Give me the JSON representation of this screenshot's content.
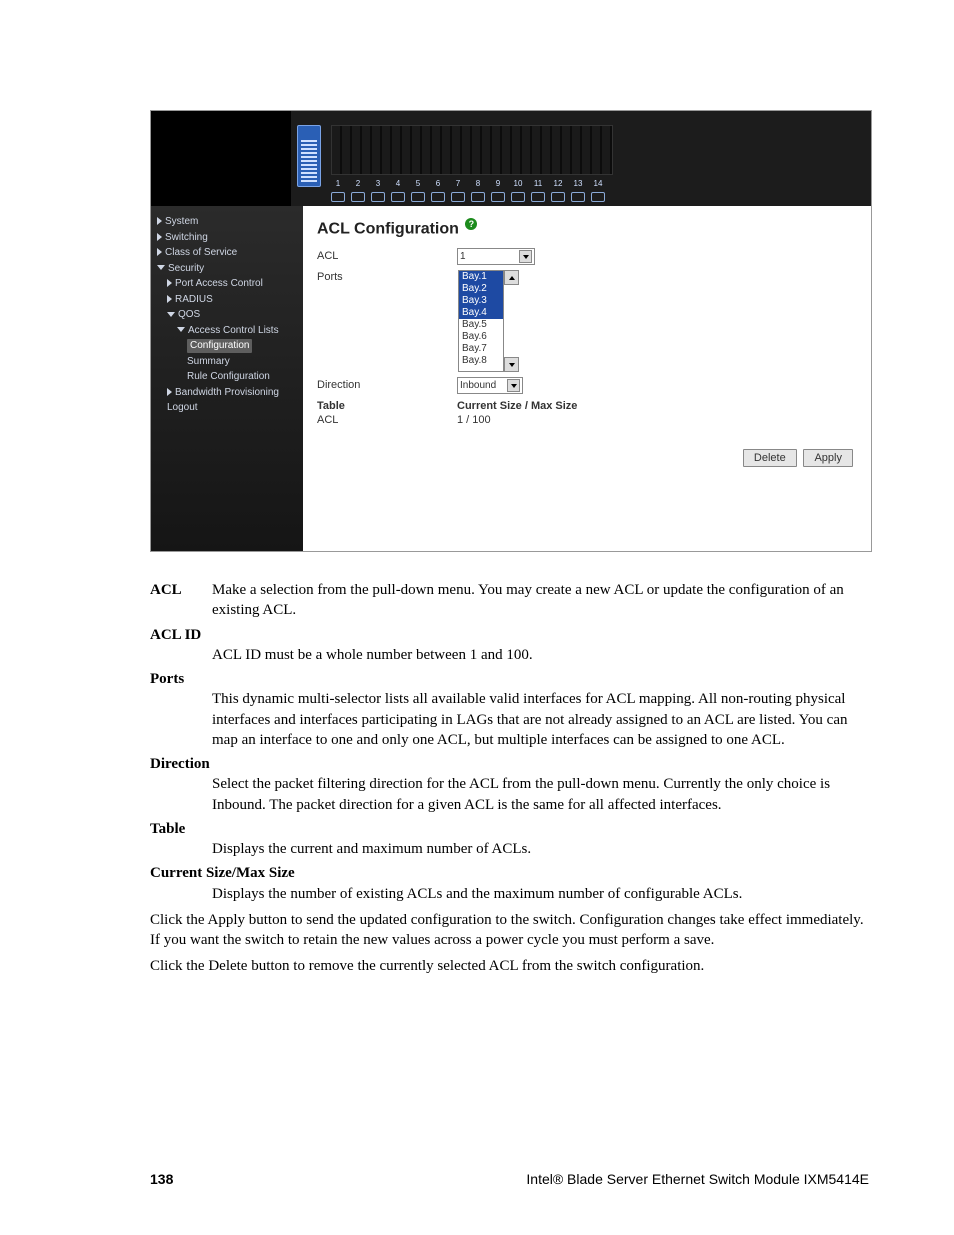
{
  "screenshot": {
    "nav": {
      "items": [
        {
          "label": "System",
          "indent": 0,
          "caret": "right"
        },
        {
          "label": "Switching",
          "indent": 0,
          "caret": "right"
        },
        {
          "label": "Class of Service",
          "indent": 0,
          "caret": "right"
        },
        {
          "label": "Security",
          "indent": 0,
          "caret": "down"
        },
        {
          "label": "Port Access Control",
          "indent": 1,
          "caret": "right"
        },
        {
          "label": "RADIUS",
          "indent": 1,
          "caret": "right"
        },
        {
          "label": "QOS",
          "indent": 1,
          "caret": "down"
        },
        {
          "label": "Access Control Lists",
          "indent": 2,
          "caret": "down"
        },
        {
          "label": "Configuration",
          "indent": 3,
          "selected": true
        },
        {
          "label": "Summary",
          "indent": 3
        },
        {
          "label": "Rule Configuration",
          "indent": 3
        },
        {
          "label": "Bandwidth Provisioning",
          "indent": 1,
          "caret": "right"
        },
        {
          "label": "Logout",
          "indent": 1
        }
      ]
    },
    "port_numbers": [
      "1",
      "2",
      "3",
      "4",
      "5",
      "6",
      "7",
      "8",
      "9",
      "10",
      "11",
      "12",
      "13",
      "14"
    ],
    "title": "ACL Configuration",
    "help_glyph": "?",
    "fields": {
      "acl": {
        "label": "ACL",
        "value": "1"
      },
      "ports": {
        "label": "Ports",
        "options": [
          "Bay.1",
          "Bay.2",
          "Bay.3",
          "Bay.4",
          "Bay.5",
          "Bay.6",
          "Bay.7",
          "Bay.8"
        ],
        "selected": [
          "Bay.1",
          "Bay.2",
          "Bay.3",
          "Bay.4"
        ]
      },
      "direction": {
        "label": "Direction",
        "value": "Inbound"
      }
    },
    "table": {
      "headers": {
        "col1": "Table",
        "col2": "Current Size / Max Size"
      },
      "row": {
        "col1": "ACL",
        "col2": "1 / 100"
      }
    },
    "buttons": {
      "delete": "Delete",
      "apply": "Apply"
    }
  },
  "doc": {
    "defs": {
      "acl": {
        "term": "ACL",
        "text": "Make a selection from the pull-down menu. You may create a new ACL or update the configuration of an existing ACL."
      },
      "aclid": {
        "term": "ACL ID",
        "text": "ACL ID must be a whole number between 1 and 100."
      },
      "ports": {
        "term": "Ports",
        "text": "This dynamic multi-selector lists all available valid interfaces for ACL mapping. All non-routing physical interfaces and interfaces participating in LAGs that are not already assigned to an ACL are listed. You can map an interface to one and only one ACL, but multiple interfaces can be assigned to one ACL."
      },
      "direction": {
        "term": "Direction",
        "text": "Select the packet filtering direction for the ACL from the pull-down menu. Currently the only choice is Inbound. The packet direction for a given ACL is the same for all affected interfaces."
      },
      "table": {
        "term": "Table",
        "text": "Displays the current and maximum number of ACLs."
      },
      "curmax": {
        "term": "Current Size/Max Size",
        "text": "Displays the number of existing ACLs and the maximum number of configurable ACLs."
      }
    },
    "p1": "Click the Apply button to send the updated configuration to the switch. Configuration changes take effect immediately. If you want the switch to retain the new values across a power cycle you must perform a save.",
    "p2": "Click the Delete button to remove the currently selected ACL from the switch configuration."
  },
  "footer": {
    "page": "138",
    "right": "Intel® Blade Server Ethernet Switch Module IXM5414E"
  }
}
